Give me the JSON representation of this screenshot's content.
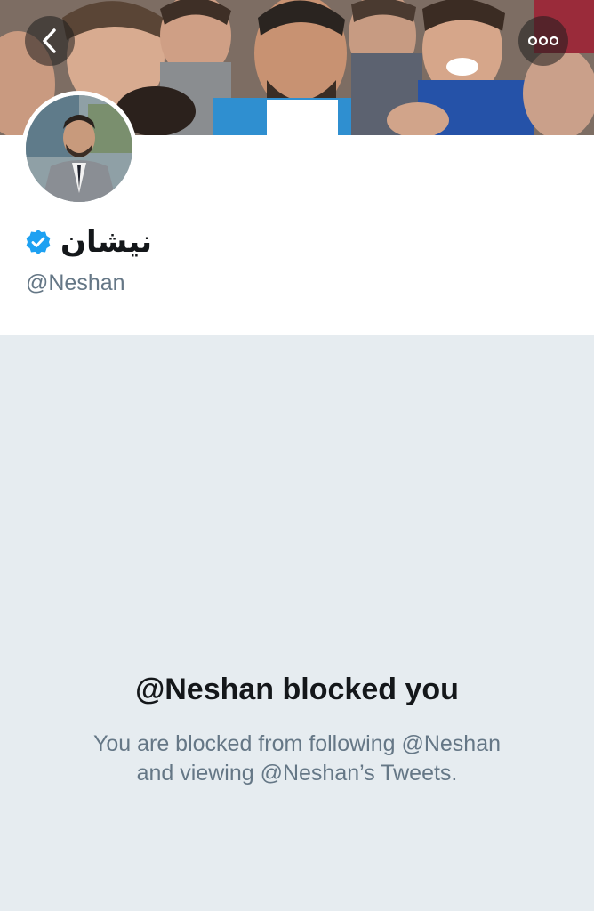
{
  "header": {
    "back_icon": "chevron-left-icon",
    "more_icon": "more-dots-icon"
  },
  "profile": {
    "display_name": "نيشان",
    "verified_icon": "verified-badge-icon",
    "handle": "@Neshan",
    "accent_color": "#1da1f2"
  },
  "blocked": {
    "title": "@Neshan blocked you",
    "line1": "You are blocked from following @Neshan",
    "line2": "and viewing @Neshan’s Tweets."
  },
  "colors": {
    "background": "#e6ecf0",
    "card": "#ffffff",
    "primary_text": "#14171a",
    "secondary_text": "#657786"
  }
}
